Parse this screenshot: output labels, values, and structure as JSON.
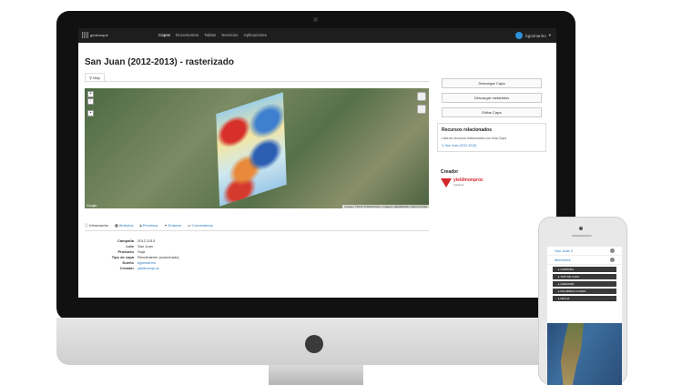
{
  "nav": {
    "logo_text": "geoknoque",
    "links": [
      "Capas",
      "Documentos",
      "Tablas",
      "Servicios",
      "Aplicaciones"
    ],
    "user": "bgonnarino"
  },
  "page": {
    "title": "San Juan (2012-2013) - rasterizado",
    "map_tab": "Map"
  },
  "map": {
    "zoom_in": "+",
    "zoom_out": "-",
    "attribution": "Imagery ©2016 CNES/Astrium, Imagery, DigitalGlobe | Terms of Use",
    "google_mark": "Google"
  },
  "side": {
    "download_layer": "Descargar Capa",
    "download_metadata": "Descargar metadatos",
    "edit_layer": "Editar Capa",
    "related_title": "Recursos relacionados",
    "related_text": "Lista de recursos relacionados con esta Capa",
    "related_link": "San Juan (2012-2013)",
    "creator_title": "Creador",
    "creator_name": "yieldmonproc",
    "creator_sub": "ingeniería"
  },
  "info_tabs": [
    "Información",
    "Atributos",
    "Permisos",
    "Enlaces",
    "Comentarios"
  ],
  "info": [
    {
      "k": "Campaña",
      "v": "2012-2013"
    },
    {
      "k": "Lote",
      "v": "San Juan"
    },
    {
      "k": "Producto",
      "v": "Soja"
    },
    {
      "k": "Tipo de capa",
      "v": "Rendimiento (cosechado)"
    },
    {
      "k": "Dueño",
      "v": "bgonnarino"
    },
    {
      "k": "Creador",
      "v": "yieldmonproc"
    }
  ],
  "phone": {
    "links": [
      "San Juan 2",
      "Mercedes"
    ],
    "menu": [
      "CAMPAÑA",
      "TIPO DE CAPA",
      "CREADOR",
      "PALABRAS CLAVES",
      "FECHA"
    ]
  }
}
